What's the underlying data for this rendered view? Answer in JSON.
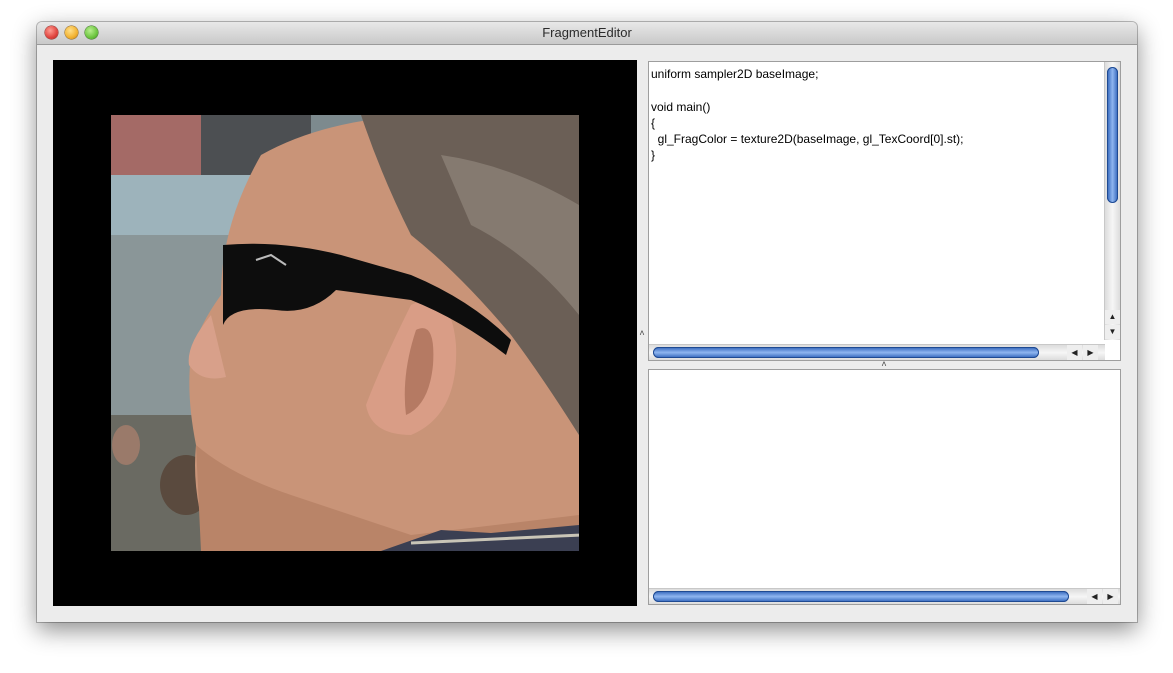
{
  "window": {
    "title": "FragmentEditor"
  },
  "editor": {
    "code": "uniform sampler2D baseImage;\n\nvoid main()\n{\n  gl_FragColor = texture2D(baseImage, gl_TexCoord[0].st);\n}"
  },
  "output": {
    "text": ""
  },
  "icons": {
    "close": "close-icon",
    "minimize": "minimize-icon",
    "zoom": "zoom-icon",
    "scroll_up": "▲",
    "scroll_down": "▼",
    "scroll_left": "◀",
    "scroll_right": "▶",
    "split_handle": "˄"
  }
}
